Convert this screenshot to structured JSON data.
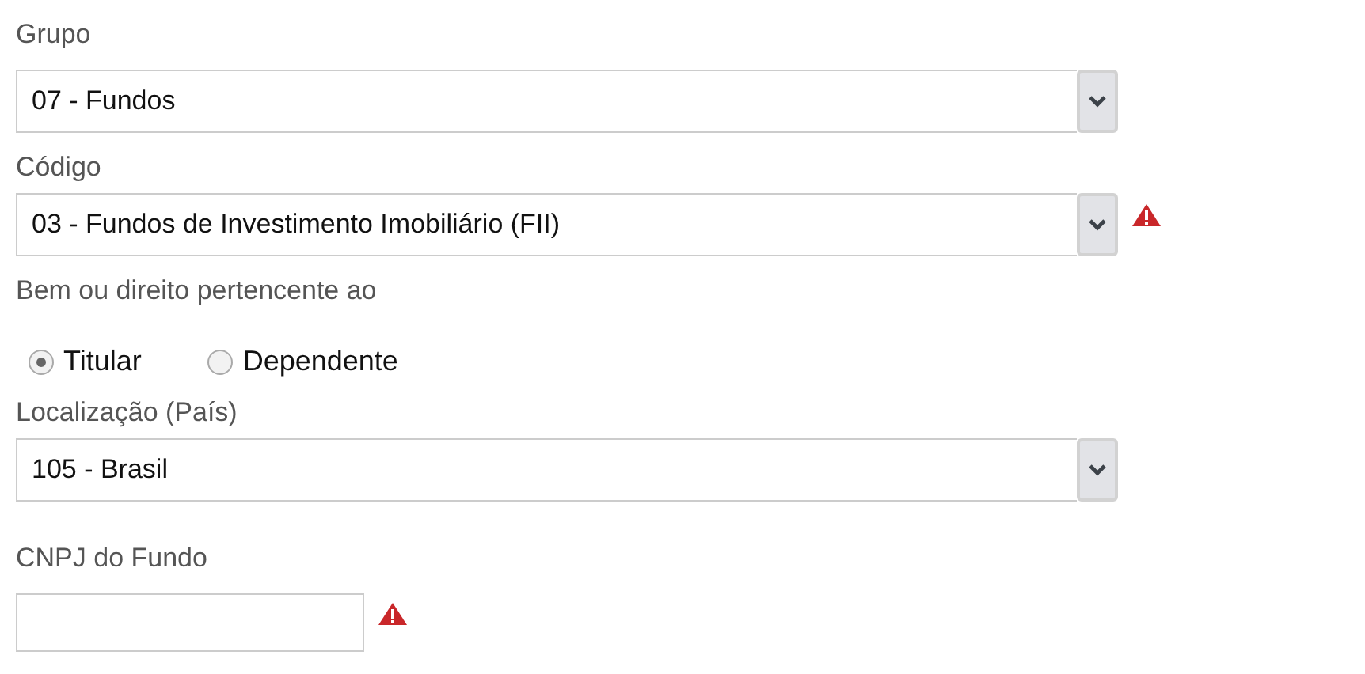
{
  "fields": [
    {
      "kind": "select",
      "label": "Grupo",
      "value": "07 - Fundos",
      "warning": false
    },
    {
      "kind": "select",
      "label": "Código",
      "value": "03 - Fundos de Investimento Imobiliário (FII)",
      "warning": true
    },
    {
      "kind": "radio",
      "label": "Bem ou direito pertencente ao",
      "options": [
        {
          "label": "Titular",
          "selected": true
        },
        {
          "label": "Dependente",
          "selected": false
        }
      ]
    },
    {
      "kind": "select",
      "label": "Localização (País)",
      "value": "105 - Brasil",
      "warning": false
    },
    {
      "kind": "text",
      "label": "CNPJ do Fundo",
      "warning": true
    }
  ]
}
